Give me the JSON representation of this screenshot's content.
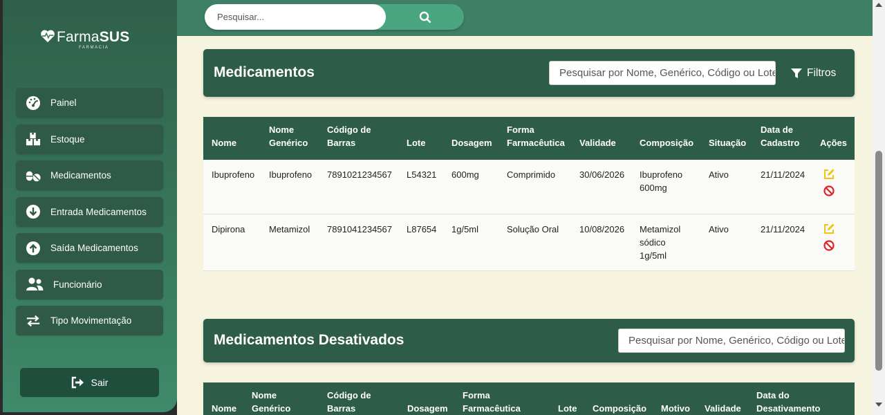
{
  "brand": {
    "name_light": "Farma",
    "name_bold": "SUS",
    "subtitle": "FARMÁCIA"
  },
  "sidebar": {
    "items": [
      {
        "label": "Painel",
        "icon": "gauge-icon"
      },
      {
        "label": "Estoque",
        "icon": "boxes-icon"
      },
      {
        "label": "Medicamentos",
        "icon": "pills-icon"
      },
      {
        "label": "Entrada Medicamentos",
        "icon": "arrow-down-circle-icon"
      },
      {
        "label": "Saída Medicamentos",
        "icon": "arrow-up-circle-icon"
      },
      {
        "label": "Funcionário",
        "icon": "users-icon"
      },
      {
        "label": "Tipo Movimentação",
        "icon": "exchange-icon"
      }
    ],
    "logout_label": "Sair"
  },
  "topbar": {
    "search_placeholder": "Pesquisar..."
  },
  "medicamentos": {
    "title": "Medicamentos",
    "filter_placeholder": "Pesquisar por Nome, Genérico, Código ou Lote",
    "filters_label": "Filtros",
    "columns": [
      "Nome",
      "Nome Genérico",
      "Código de Barras",
      "Lote",
      "Dosagem",
      "Forma Farmacêutica",
      "Validade",
      "Composição",
      "Situação",
      "Data de Cadastro",
      "Ações"
    ],
    "rows": [
      {
        "nome": "Ibuprofeno",
        "generico": "Ibuprofeno",
        "codigo": "7891021234567",
        "lote": "L54321",
        "dosagem": "600mg",
        "forma": "Comprimido",
        "validade": "30/06/2026",
        "composicao": "Ibuprofeno 600mg",
        "situacao": "Ativo",
        "cadastro": "21/11/2024"
      },
      {
        "nome": "Dipirona",
        "generico": "Metamizol",
        "codigo": "7891041234567",
        "lote": "L87654",
        "dosagem": "1g/5ml",
        "forma": "Solução Oral",
        "validade": "10/08/2026",
        "composicao": "Metamizol sódico 1g/5ml",
        "situacao": "Ativo",
        "cadastro": "21/11/2024"
      }
    ]
  },
  "desativados": {
    "title": "Medicamentos Desativados",
    "filter_placeholder": "Pesquisar por Nome, Genérico, Código ou Lote",
    "columns": [
      "Nome",
      "Nome Genérico",
      "Código de Barras",
      "Dosagem",
      "Forma Farmacêutica",
      "Lote",
      "Composição",
      "Motivo",
      "Validade",
      "Data do Desativamento"
    ]
  },
  "colors": {
    "primary": "#2d5c49",
    "accent": "#4aa681",
    "background": "#f6f3de",
    "edit": "#f2c40f",
    "disable": "#e0202a"
  }
}
